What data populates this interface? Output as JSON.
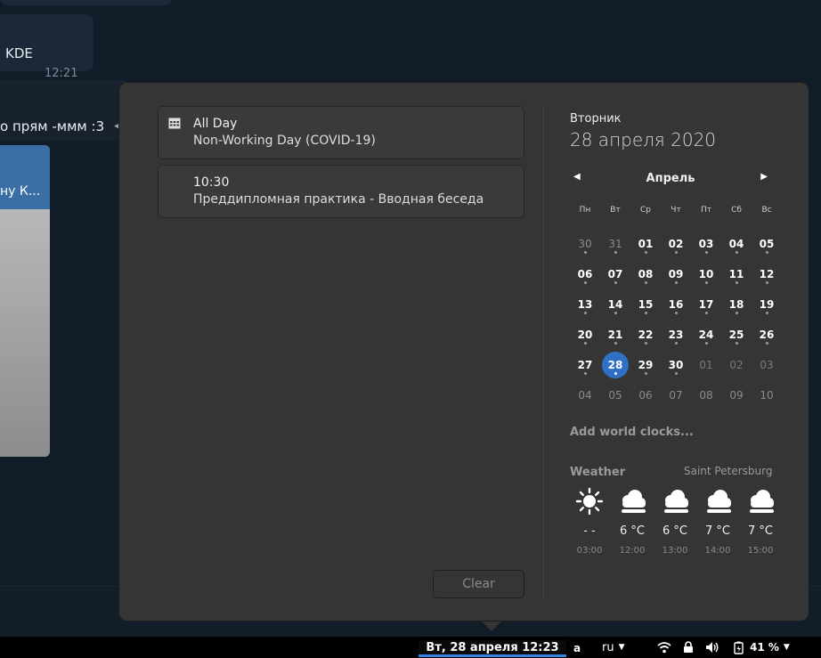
{
  "chat": {
    "message_kde": "KDE",
    "message_kde_time": "12:21",
    "message_second": "о прям -ммм :3",
    "preview_title": "ну К..."
  },
  "topbar": {
    "clock": "Вт, 28 апреля  12:23",
    "input_source": "ru",
    "battery_percent": "41 %"
  },
  "events": [
    {
      "title": "All Day",
      "subtitle": "Non-Working Day (COVID-19)",
      "icon": "calendar-grid-icon"
    },
    {
      "title": "10:30",
      "subtitle": "Преддипломная практика - Вводная беседа"
    }
  ],
  "clear_label": "Clear",
  "calendar": {
    "day_of_week": "Вторник",
    "full_date": "28 апреля 2020",
    "month": "Апрель",
    "weekdays": [
      "Пн",
      "Вт",
      "Ср",
      "Чт",
      "Пт",
      "Сб",
      "Вс"
    ],
    "weeks": [
      [
        "30",
        "31",
        "01",
        "02",
        "03",
        "04",
        "05"
      ],
      [
        "06",
        "07",
        "08",
        "09",
        "10",
        "11",
        "12"
      ],
      [
        "13",
        "14",
        "15",
        "16",
        "17",
        "18",
        "19"
      ],
      [
        "20",
        "21",
        "22",
        "23",
        "24",
        "25",
        "26"
      ],
      [
        "27",
        "28",
        "29",
        "30",
        "01",
        "02",
        "03"
      ],
      [
        "04",
        "05",
        "06",
        "07",
        "08",
        "09",
        "10"
      ]
    ],
    "today": "28"
  },
  "world_clocks_label": "Add world clocks...",
  "weather": {
    "title": "Weather",
    "location": "Saint Petersburg",
    "forecast": [
      {
        "icon": "sun-icon",
        "temp": "- -",
        "hour": "03:00"
      },
      {
        "icon": "cloud-icon",
        "temp": "6 °C",
        "hour": "12:00"
      },
      {
        "icon": "cloud-icon",
        "temp": "6 °C",
        "hour": "13:00"
      },
      {
        "icon": "cloud-icon",
        "temp": "7 °C",
        "hour": "14:00"
      },
      {
        "icon": "cloud-icon",
        "temp": "7 °C",
        "hour": "15:00"
      }
    ]
  },
  "colors": {
    "accent": "#2f6fc6",
    "popover_bg": "#353535",
    "panel_bg": "#000000"
  }
}
